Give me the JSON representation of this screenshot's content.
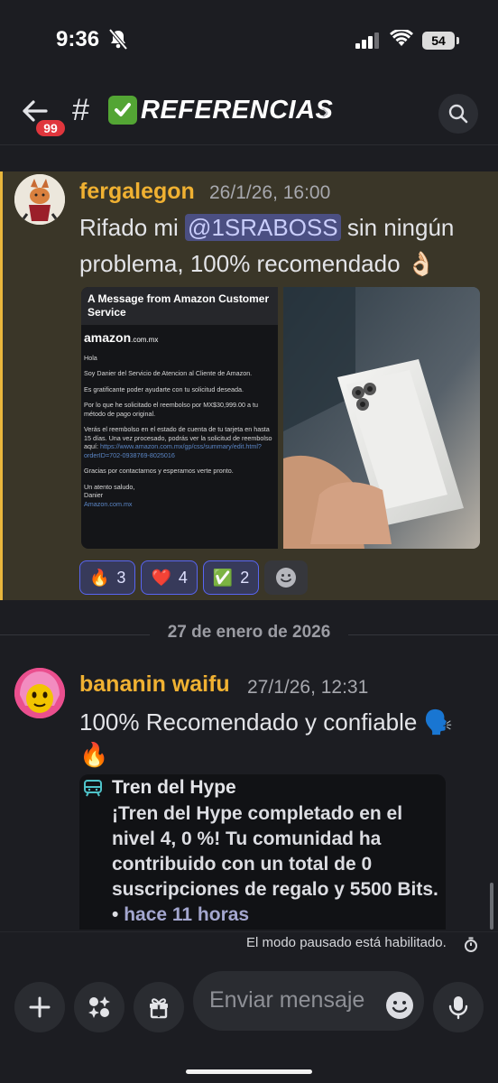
{
  "status_bar": {
    "time": "9:36",
    "battery": "54"
  },
  "header": {
    "back_badge": "99",
    "hash": "#",
    "channel_name": "REFERENCIAS",
    "chevron": "›"
  },
  "message1": {
    "author": "fergalegon",
    "timestamp": "26/1/26, 16:00",
    "text_before": "Rifado mi ",
    "mention": "@1SRABOSS",
    "text_after": " sin ningún problema, 100% recomendado 👌🏻",
    "image_email": {
      "heading": "A Message from Amazon Customer Service",
      "logo": "amazon",
      "logo_suffix": ".com.mx",
      "greeting": "Hola",
      "line1": "Soy Danier del Servicio de Atencion al Cliente de Amazon.",
      "line2": "Es gratificante poder ayudarte con tu solicitud deseada.",
      "line3": "Por lo que he solicitado el reembolso por MX$30,999.00 a tu método de pago original.",
      "line4": "Verás el reembolso en el estado de cuenta de tu tarjeta en hasta 15 días. Una vez procesado, podrás ver la solicitud de reembolso aquí: ",
      "link": "https://www.amazon.com.mx/gp/css/summary/edit.html?orderID=702-0938769-8025016",
      "line5": "Gracias por contactarnos y esperamos verte pronto.",
      "sign1": "Un atento saludo,",
      "sign2": "Danier",
      "sign3": "Amazon.com.mx"
    },
    "reactions": [
      {
        "emoji": "🔥",
        "count": "3"
      },
      {
        "emoji": "❤️",
        "count": "4"
      },
      {
        "emoji": "✅",
        "count": "2"
      }
    ]
  },
  "date_separator": "27 de enero de 2026",
  "message2": {
    "author": "bananin waifu",
    "timestamp": "27/1/26, 12:31",
    "text_line1": "100% Recomendado y confiable 🗣️",
    "text_line2": "🔥",
    "embed": {
      "title": "Tren del Hype",
      "body": "¡Tren del Hype completado en el nivel 4, 0 %! Tu comunidad ha contribuido con un total de 0 suscripciones de regalo y 5500 Bits. • ",
      "time": "hace 11 horas"
    }
  },
  "footer": {
    "paused_notice": "El modo pausado está habilitado.",
    "input_placeholder": "Enviar mensaje"
  },
  "colors": {
    "background": "#1c1d22",
    "highlight_bg": "#3a3628",
    "highlight_bar": "#e9b73c",
    "author": "#f0b132",
    "mention_bg": "#4b4f82",
    "reaction_border": "#5865f2",
    "badge": "#e0363d"
  }
}
